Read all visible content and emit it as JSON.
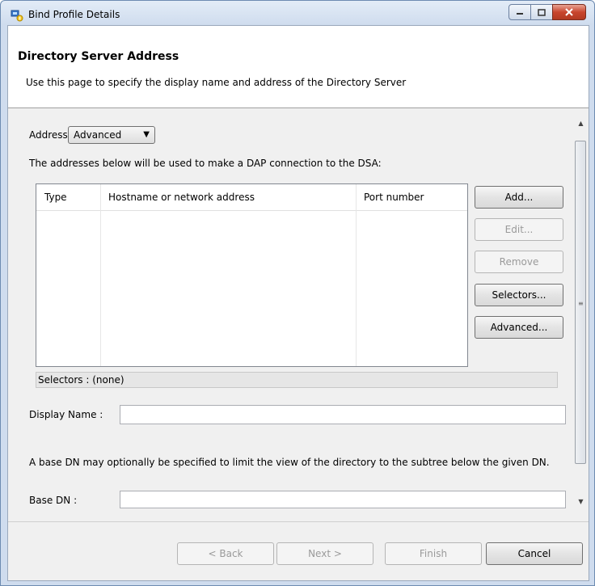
{
  "window": {
    "title": "Bind Profile Details",
    "icon": "bind-profile-icon",
    "controls": {
      "minimize": "minimize-icon",
      "maximize": "maximize-icon",
      "close": "close-icon"
    }
  },
  "header": {
    "title": "Directory Server Address",
    "description": "Use this page to specify the display name and address of the Directory Server"
  },
  "form": {
    "address_label": "Address :",
    "address_value": "Advanced",
    "addresses_note": "The addresses below will be used to make a DAP connection to the DSA:",
    "table": {
      "columns": [
        "Type",
        "Hostname or network address",
        "Port number"
      ],
      "rows": []
    },
    "side_buttons": [
      {
        "label": "Add...",
        "enabled": true
      },
      {
        "label": "Edit...",
        "enabled": false
      },
      {
        "label": "Remove",
        "enabled": false
      },
      {
        "label": "Selectors...",
        "enabled": true
      },
      {
        "label": "Advanced...",
        "enabled": true
      }
    ],
    "selectors_status": "Selectors : (none)",
    "display_name_label": "Display Name :",
    "display_name_value": "",
    "base_dn_note": "A base DN may optionally be specified to limit the view of the directory to the subtree below the given DN.",
    "base_dn_label": "Base DN :",
    "base_dn_value": ""
  },
  "footer": {
    "buttons": [
      {
        "label": "< Back",
        "enabled": false
      },
      {
        "label": "Next >",
        "enabled": false
      },
      {
        "label": "Finish",
        "enabled": false
      },
      {
        "label": "Cancel",
        "enabled": true
      }
    ]
  }
}
